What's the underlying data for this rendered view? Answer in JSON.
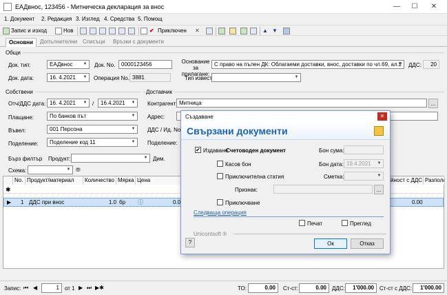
{
  "window": {
    "title": "ЕАДвнос, 123456 - Митническа декларация за внос",
    "minimize": "—",
    "maximize": "☐",
    "close": "✕"
  },
  "menu": [
    "1. Документ",
    "2. Редакция",
    "3. Изглед",
    "4. Средства",
    "5. Помощ"
  ],
  "toolbar": {
    "save_exit": "Запис и изход",
    "new": "Нов",
    "close_doc": "Приключен"
  },
  "tabs": [
    "Основни",
    "Допълнителни",
    "Списъци",
    "Връзки с документи"
  ],
  "general": {
    "title": "Общи",
    "doc_type_label": "Док. тип:",
    "doc_type": "ЕАДвнос",
    "doc_no_label": "Док. No.",
    "doc_no": "0000123456",
    "doc_date_label": "Док. дата:",
    "doc_date": "16. 4.2021",
    "op_no_label": "Операция No.",
    "op_no": "3881",
    "basis_label": "Основание за прилагане:",
    "basis": "С право на пълен ДК: Облагаеми доставки, внос, доставки по чл.69, ал.2",
    "vat_label": "ДДС:",
    "vat": "20",
    "notice_label": "Тип известие:",
    "notice": ""
  },
  "own": {
    "title": "Собствени",
    "vat_date_label": "Отч/ДДС дата:",
    "vat_date": "16. 4.2021",
    "slash": "/",
    "vat_date2": "16.4.2021",
    "payment_label": "Плащане:",
    "payment": "По банков път",
    "entered_label": "Въвел:",
    "entered": "001 Персона",
    "division_label": "Поделение:",
    "division": "Поделение код 11"
  },
  "supplier": {
    "title": "Доставчик",
    "partner_label": "Контрагент:",
    "partner": "Митница",
    "address_label": "Адрес:",
    "vat_id_label": "ДДС / Ид. No.",
    "division_label": "Поделение:",
    "browse": "..."
  },
  "filter": {
    "quick_label": "Бърз филтър",
    "product_label": "Продукт:",
    "dim_label": "Дим.",
    "scheme_label": "Схема:"
  },
  "grid": {
    "headers": [
      "No.",
      "Продукт/материал",
      "Количество",
      "Мярка",
      "Цена",
      "йност с ДДС",
      "Разполаг"
    ],
    "new_marker": "✱",
    "row": {
      "no": "1",
      "product": "ДДС при внос",
      "qty": "1.0",
      "unit": "бр",
      "price": "0.00",
      "total": "0.00"
    }
  },
  "status": {
    "record_label": "Запис:",
    "record": "1",
    "of": "от 1",
    "to_label": "ТО:",
    "to": "0.00",
    "st_label": "Ст-ст:",
    "st": "0.00",
    "vat_label": "ДДС:",
    "vat": "1'000.00",
    "st_vat_label": "Ст-ст с ДДС:",
    "st_vat": "1'000.00"
  },
  "dialog": {
    "title": "Създаване",
    "heading": "Свързани документи",
    "issuance_label": "Издаване",
    "issuance": "Счетоводен документ",
    "cash_label": "Касов бон",
    "article_label": "Приключителна статия",
    "sign_label": "Признак:",
    "close_label": "Приключване",
    "next_op": "Следваща операция",
    "receipt_sum_label": "Бон сума:",
    "receipt_date_label": "Бон дата:",
    "receipt_date": "19.4.2021",
    "account_label": "Сметка:",
    "vendor": "Unicontsoft ®",
    "print_label": "Печат",
    "preview_label": "Преглед",
    "ok": "Ок",
    "cancel": "Отказ",
    "help": "?",
    "close": "✕"
  }
}
